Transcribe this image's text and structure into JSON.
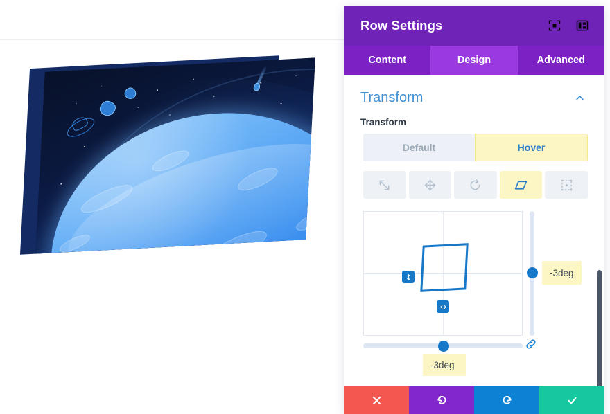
{
  "panel": {
    "title": "Row Settings",
    "header_icons": [
      {
        "name": "focus-target-icon"
      },
      {
        "name": "layout-panel-icon"
      }
    ],
    "tabs": [
      {
        "label": "Content",
        "active": false
      },
      {
        "label": "Design",
        "active": true
      },
      {
        "label": "Advanced",
        "active": false
      }
    ],
    "section": {
      "title": "Transform",
      "collapse_icon": "chevron-up-icon",
      "field_label": "Transform",
      "state_toggle": {
        "options": [
          {
            "label": "Default",
            "active": false
          },
          {
            "label": "Hover",
            "active": true
          }
        ]
      },
      "modes": [
        {
          "name": "scale-icon",
          "active": false
        },
        {
          "name": "move-icon",
          "active": false
        },
        {
          "name": "rotate-icon",
          "active": false
        },
        {
          "name": "skew-icon",
          "active": true
        },
        {
          "name": "origin-icon",
          "active": false
        }
      ],
      "canvas": {
        "vertical_value": "-3deg",
        "horizontal_value": "-3deg",
        "link_icon": "broken-link-icon",
        "vertical_handle_icon": "vertical-resize-icon",
        "horizontal_handle_icon": "horizontal-resize-icon"
      }
    },
    "footer_buttons": [
      {
        "name": "cancel-button",
        "icon": "close-icon",
        "color": "#f4574f"
      },
      {
        "name": "undo-button",
        "icon": "undo-icon",
        "color": "#8227cc"
      },
      {
        "name": "redo-button",
        "icon": "redo-icon",
        "color": "#0d82d4"
      },
      {
        "name": "save-button",
        "icon": "check-icon",
        "color": "#15c8a0"
      }
    ]
  },
  "colors": {
    "header_purple": "#7024b7",
    "tab_active": "#9b39e0",
    "accent_blue": "#1878c8",
    "highlight_yellow": "#fbf6c4",
    "section_title_blue": "#3f8fd4",
    "scrollbar": "#4a5568"
  },
  "preview": {
    "name": "space-planet-illustration",
    "back_layer_color": "#132a63",
    "elements": [
      "planet",
      "moon",
      "asteroids",
      "ufo",
      "comet",
      "stars"
    ]
  }
}
